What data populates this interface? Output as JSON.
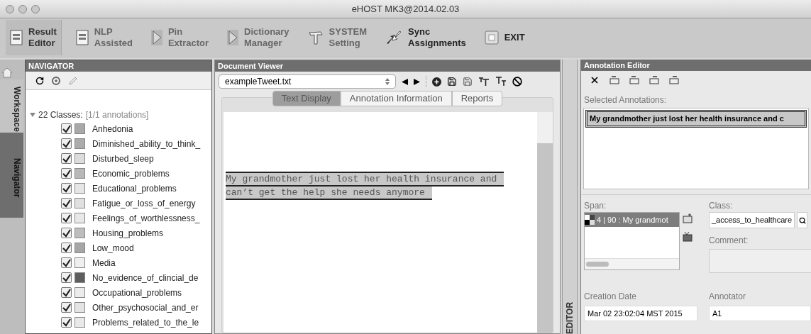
{
  "window": {
    "title": "eHOST MK3@2014.02.03"
  },
  "toolbar": [
    {
      "kind": "doc",
      "line1": "Result",
      "line2": "Editor",
      "selected": true
    },
    {
      "kind": "doc",
      "line1": "NLP",
      "line2": "Assisted",
      "selected": false
    },
    {
      "kind": "play",
      "line1": "Pin",
      "line2": "Extractor",
      "selected": false
    },
    {
      "kind": "play",
      "line1": "Dictionary",
      "line2": "Manager",
      "selected": false
    },
    {
      "kind": "tool",
      "line1": "SYSTEM",
      "line2": "Setting",
      "selected": false
    },
    {
      "kind": "sync",
      "line1": "Sync",
      "line2": "Assignments",
      "selected": false
    },
    {
      "kind": "exit",
      "line1": "EXIT",
      "selected": false
    }
  ],
  "side_tabs": [
    {
      "label": "Workspace",
      "selected": false
    },
    {
      "label": "Navigator",
      "selected": true
    }
  ],
  "navigator": {
    "title": "NAVIGATOR",
    "root": {
      "count": "22 Classes:",
      "info": "[1/1 annotations]",
      "expanded": true,
      "children": [
        {
          "label": "Anhedonia",
          "checked": true,
          "color": "#a8a8a8"
        },
        {
          "label": "Diminished_ability_to_think_",
          "checked": true,
          "color": "#ababab"
        },
        {
          "label": "Disturbed_sleep",
          "checked": true,
          "color": "#dcdcdc"
        },
        {
          "label": "Economic_problems",
          "checked": true,
          "color": "#b8b8b8"
        },
        {
          "label": "Educational_problems",
          "checked": true,
          "color": "#e6e6e6"
        },
        {
          "label": "Fatigue_or_loss_of_energy",
          "checked": true,
          "color": "#e0e0e0"
        },
        {
          "label": "Feelings_of_worthlessness_",
          "checked": true,
          "color": "#e8e8e8"
        },
        {
          "label": "Housing_problems",
          "checked": true,
          "color": "#bdbdbd"
        },
        {
          "label": "Low_mood",
          "checked": true,
          "color": "#a6a6a6"
        },
        {
          "label": "Media",
          "checked": true,
          "color": "#efefef"
        },
        {
          "label": "No_evidence_of_clincial_de",
          "checked": true,
          "color": "#5e5e5e"
        },
        {
          "label": "Occupational_problems",
          "checked": true,
          "color": "#ececec"
        },
        {
          "label": "Other_psychosocial_and_er",
          "checked": true,
          "color": "#e4e4e4"
        },
        {
          "label": "Problems_related_to_the_le",
          "checked": true,
          "color": "#e9e9e9"
        }
      ]
    }
  },
  "document_viewer": {
    "title": "Document Viewer",
    "file": "exampleTweet.txt",
    "tabs": [
      {
        "label": "Text Display",
        "selected": true
      },
      {
        "label": "Annotation Information",
        "selected": false
      },
      {
        "label": "Reports",
        "selected": false
      }
    ],
    "lines": [
      "My grandmother just lost her health insurance and",
      "can’t get the help she needs anymore"
    ]
  },
  "editor_tab": {
    "label": "EDITOR"
  },
  "annotation_editor": {
    "title": "Annotation Editor",
    "selected_label": "Selected Annotations:",
    "selected_annotations": [
      {
        "text": "My grandmother just lost her health insurance and c",
        "selected": true
      }
    ],
    "span_label": "Span:",
    "spans": [
      {
        "text": "4 | 90 : My grandmot",
        "selected": true
      }
    ],
    "class_label": "Class:",
    "class_value": "_access_to_healthcare",
    "comment_label": "Comment:",
    "creation_date_label": "Creation Date",
    "creation_date": "Mar 02 23:02:04 MST 2015",
    "annotator_label": "Annotator",
    "annotator": "A1"
  }
}
